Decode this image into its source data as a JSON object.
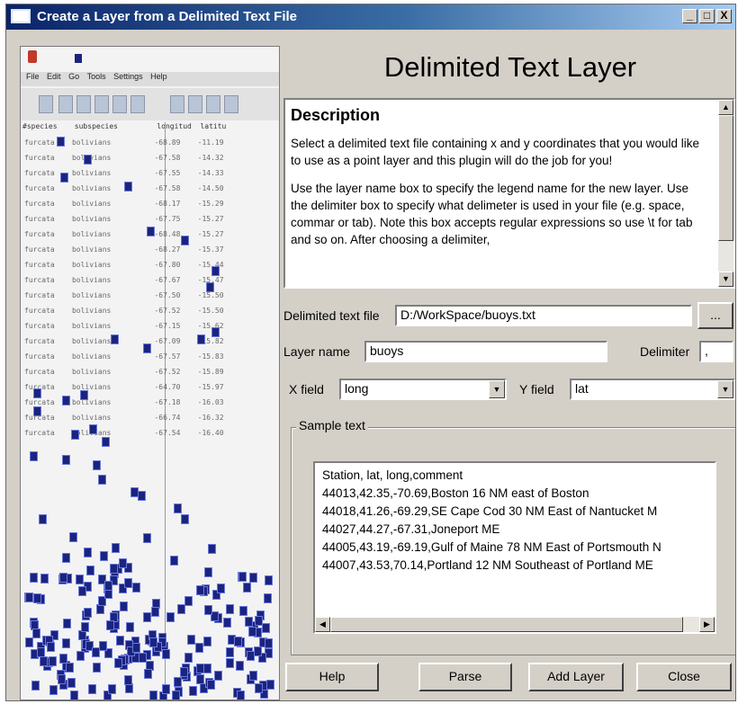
{
  "window": {
    "title": "Create a Layer from a Delimited Text File",
    "minimize_label": "_",
    "maximize_label": "□",
    "close_label": "X"
  },
  "preview": {
    "menu": [
      "File",
      "Edit",
      "Go",
      "Tools",
      "Settings",
      "Help"
    ],
    "columns": "#species    subspecies         longitud  latitu",
    "rows": [
      [
        "furcata",
        "bolivians",
        "-68.89",
        "-11.19"
      ],
      [
        "furcata",
        "bolivians",
        "-67.58",
        "-14.32"
      ],
      [
        "furcata",
        "bolivians",
        "-67.55",
        "-14.33"
      ],
      [
        "furcata",
        "bolivians",
        "-67.58",
        "-14.50"
      ],
      [
        "furcata",
        "bolivians",
        "-68.17",
        "-15.29"
      ],
      [
        "furcata",
        "bolivians",
        "-67.75",
        "-15.27"
      ],
      [
        "furcata",
        "bolivians",
        "-68.48",
        "-15.27"
      ],
      [
        "furcata",
        "bolivians",
        "-68.27",
        "-15.37"
      ],
      [
        "furcata",
        "bolivians",
        "-67.80",
        "-15.44"
      ],
      [
        "furcata",
        "bolivians",
        "-67.67",
        "-15.47"
      ],
      [
        "furcata",
        "bolivians",
        "-67.50",
        "-15.50"
      ],
      [
        "furcata",
        "bolivians",
        "-67.52",
        "-15.50"
      ],
      [
        "furcata",
        "bolivians",
        "-67.15",
        "-15.62"
      ],
      [
        "furcata",
        "bolivians",
        "-67.09",
        "-15.82"
      ],
      [
        "furcata",
        "bolivians",
        "-67.57",
        "-15.83"
      ],
      [
        "furcata",
        "bolivians",
        "-67.52",
        "-15.89"
      ],
      [
        "furcata",
        "bolivians",
        "-64.70",
        "-15.97"
      ],
      [
        "furcata",
        "bolivians",
        "-67.18",
        "-16.03"
      ],
      [
        "furcata",
        "bolivians",
        "-66.74",
        "-16.32"
      ],
      [
        "furcata",
        "bolivians",
        "-67.54",
        "-16.40"
      ]
    ]
  },
  "heading": "Delimited Text Layer",
  "description": {
    "title": "Description",
    "paragraph1": "Select a delimited text file containing x and y coordinates that you would like to use as a point layer and this plugin will do the job for you!",
    "paragraph2": "Use the layer name box to specify the legend name for the new layer. Use the delimiter box to specify what delimeter is used in your file (e.g. space, commar or tab). Note this box accepts regular expressions so use \\t for tab and so on. After choosing a delimiter,"
  },
  "form": {
    "file_label": "Delimited text file",
    "file_value": "D:/WorkSpace/buoys.txt",
    "browse_label": "...",
    "layer_label": "Layer name",
    "layer_value": "buoys",
    "delimiter_label": "Delimiter",
    "delimiter_value": ",",
    "xfield_label": "X field",
    "xfield_value": "long",
    "yfield_label": "Y field",
    "yfield_value": "lat"
  },
  "sample": {
    "legend": "Sample text",
    "lines": [
      "Station, lat, long,comment",
      "44013,42.35,-70.69,Boston 16 NM east of Boston",
      "44018,41.26,-69.29,SE Cape Cod 30 NM East of Nantucket M",
      "44027,44.27,-67.31,Joneport ME",
      "44005,43.19,-69.19,Gulf of Maine 78 NM East of Portsmouth N",
      "44007,43.53,70.14,Portland 12 NM Southeast of Portland ME"
    ]
  },
  "buttons": {
    "help": "Help",
    "parse": "Parse",
    "add_layer": "Add Layer",
    "close": "Close"
  }
}
